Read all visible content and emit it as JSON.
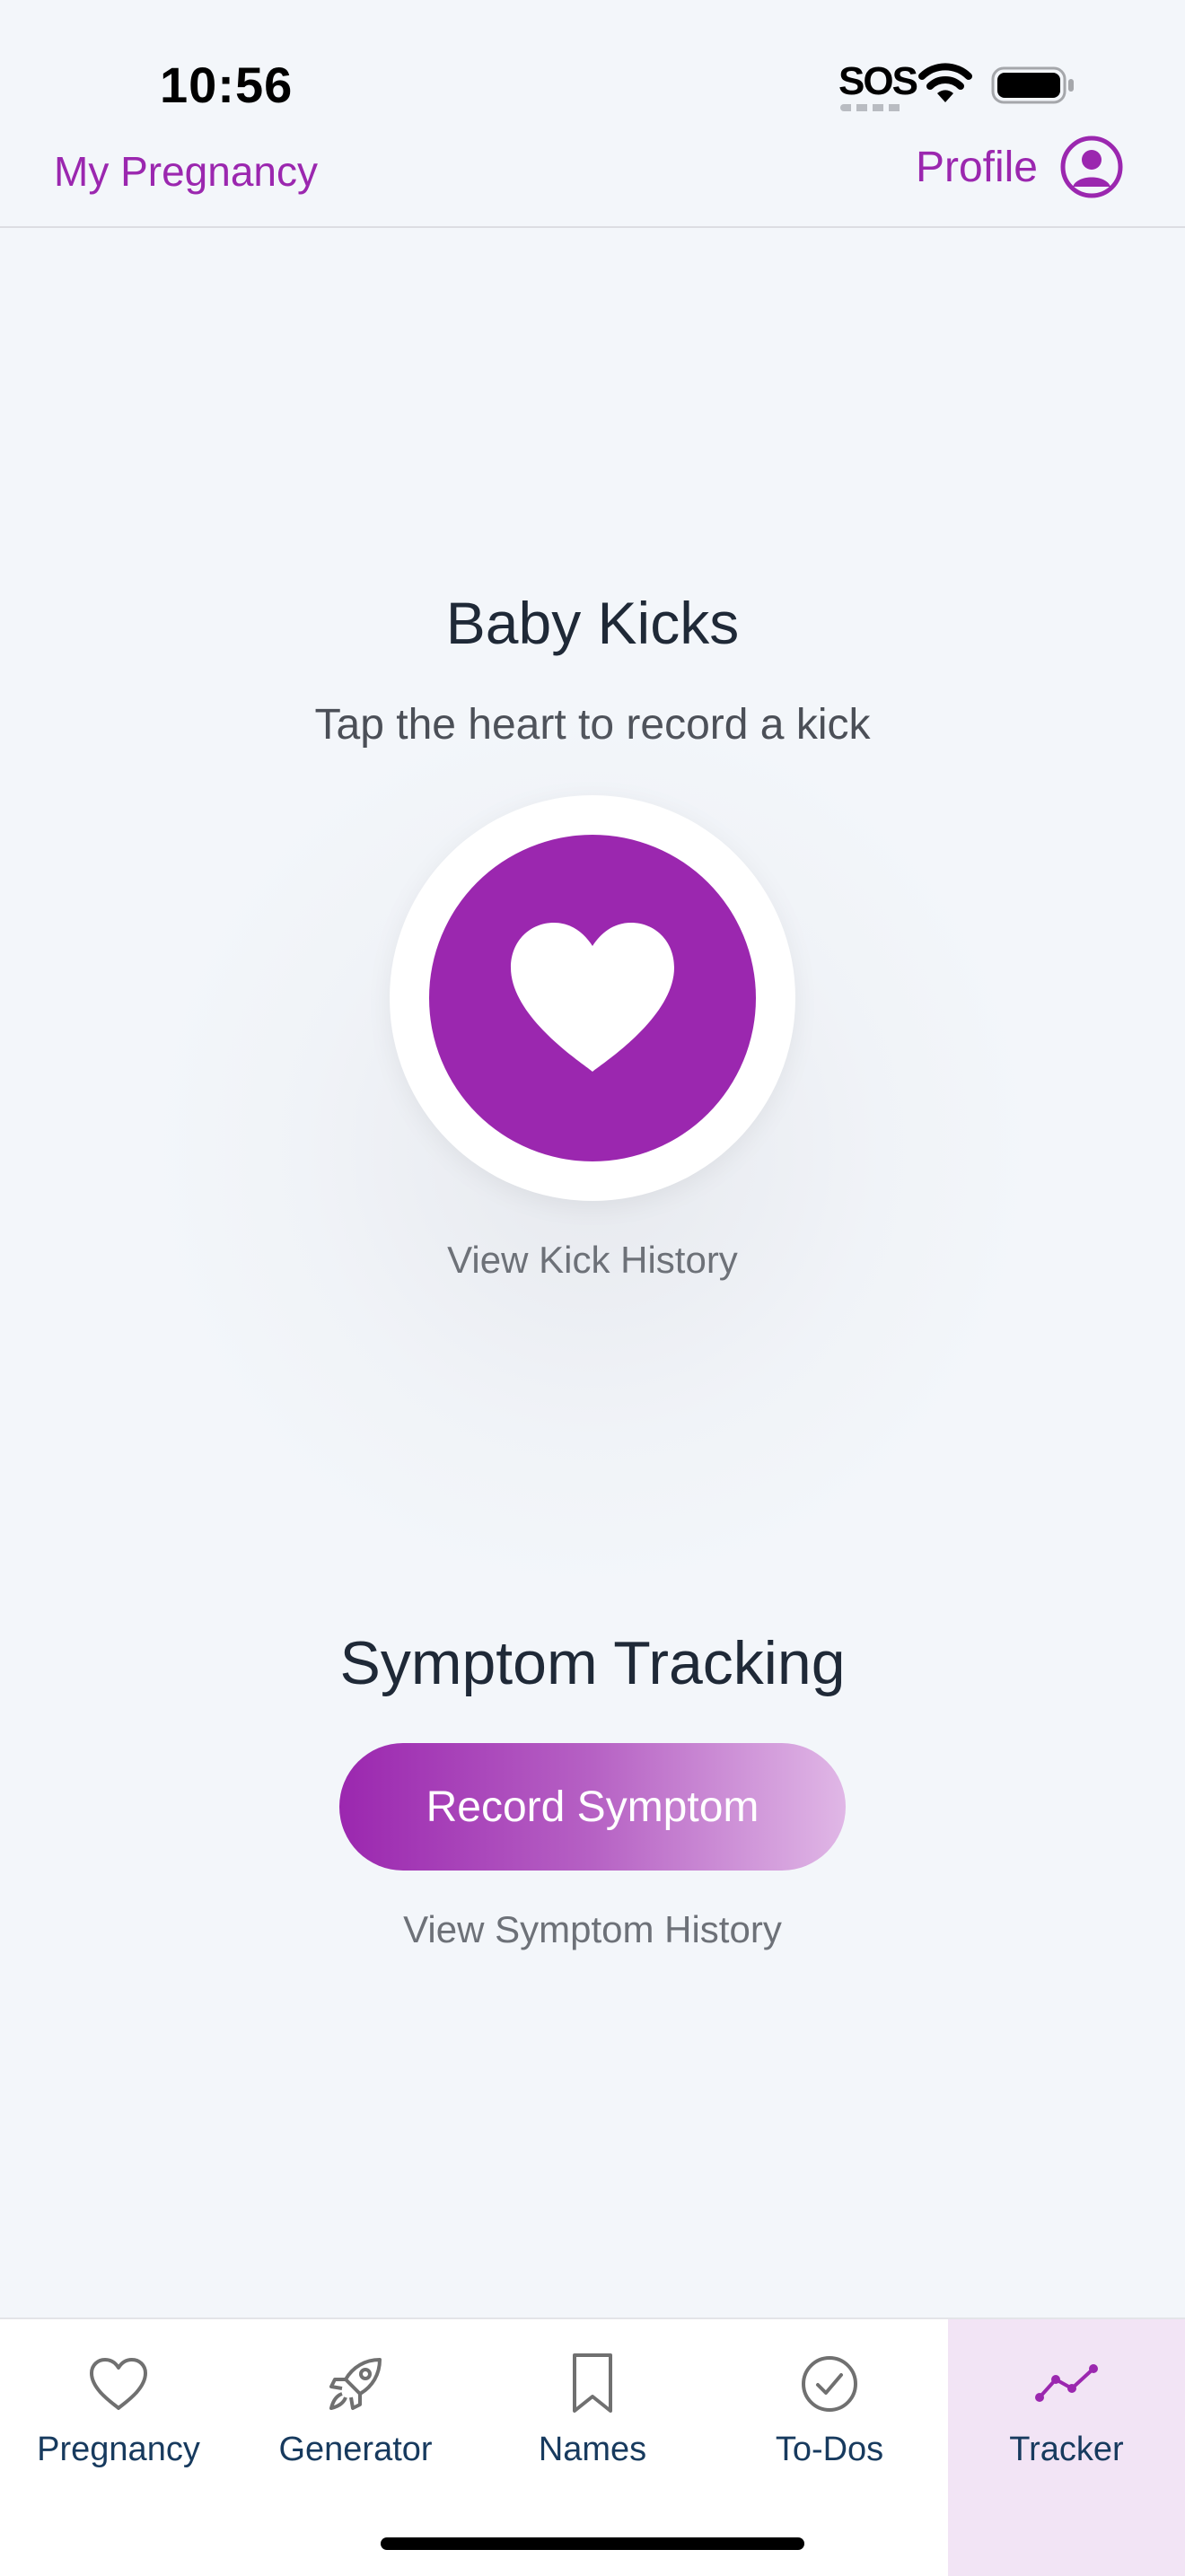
{
  "status_bar": {
    "time": "10:56",
    "sos": "SOS"
  },
  "nav": {
    "title": "My Pregnancy",
    "profile_label": "Profile",
    "profile_icon": "person-circle-icon"
  },
  "kicks": {
    "title": "Baby Kicks",
    "subtitle": "Tap the heart to record a kick",
    "heart_icon": "heart-icon",
    "history_link": "View Kick History"
  },
  "symptoms": {
    "title": "Symptom Tracking",
    "record_button": "Record Symptom",
    "history_link": "View Symptom History"
  },
  "tabs": [
    {
      "label": "Pregnancy",
      "icon": "heart-outline-icon",
      "active": false
    },
    {
      "label": "Generator",
      "icon": "rocket-icon",
      "active": false
    },
    {
      "label": "Names",
      "icon": "bookmark-icon",
      "active": false
    },
    {
      "label": "To-Dos",
      "icon": "check-circle-icon",
      "active": false
    },
    {
      "label": "Tracker",
      "icon": "trend-line-icon",
      "active": true
    }
  ],
  "colors": {
    "accent": "#9b27af",
    "background": "#f3f6fa",
    "tab_active_bg": "#f2e4f5",
    "tab_label": "#173a5e"
  }
}
